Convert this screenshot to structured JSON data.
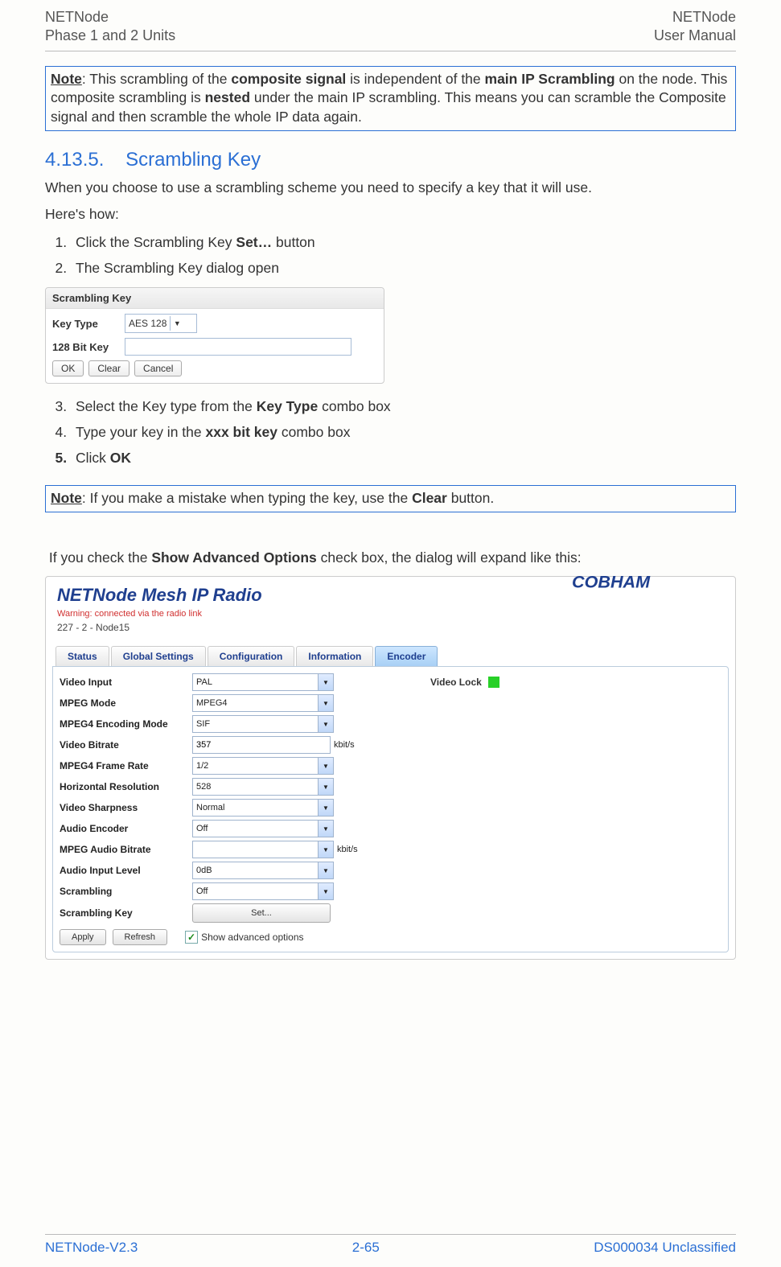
{
  "header": {
    "left_line1": "NETNode",
    "left_line2": "Phase 1 and 2 Units",
    "right_line1": "NETNode",
    "right_line2": "User Manual"
  },
  "note1": {
    "prefix": "Note",
    "text1": ": This scrambling of the ",
    "bold1": "composite signal",
    "text2": " is independent of the ",
    "bold2": "main IP Scrambling",
    "text3": " on the node. This composite scrambling is ",
    "bold3": "nested",
    "text4": " under the main IP scrambling. This means you can scramble the Composite signal and then scramble the whole IP data again."
  },
  "section": {
    "number": "4.13.5.",
    "title": "Scrambling Key"
  },
  "intro1": "When you choose to use a scrambling scheme you need to specify a key that it will use.",
  "intro2": "Here's how:",
  "steps12": {
    "s1_a": "Click the Scrambling Key ",
    "s1_b": "Set…",
    "s1_c": " button",
    "s2": "The Scrambling Key dialog open"
  },
  "sk_dialog": {
    "title": "Scrambling Key",
    "lbl_keytype": "Key Type",
    "val_keytype": "AES 128",
    "lbl_bitkey": "128 Bit Key",
    "btn_ok": "OK",
    "btn_clear": "Clear",
    "btn_cancel": "Cancel"
  },
  "steps345": {
    "s3_a": "Select the Key type from the ",
    "s3_b": "Key Type",
    "s3_c": " combo box",
    "s4_a": "Type your key in the ",
    "s4_b": "xxx bit key",
    "s4_c": " combo box",
    "s5_a": "Click ",
    "s5_b": "OK"
  },
  "note2": {
    "prefix": "Note",
    "t1": ": If you make a mistake when typing the key, use the ",
    "b1": "Clear",
    "t2": " button."
  },
  "advanced_text": {
    "t1": "If you check the ",
    "b1": "Show Advanced Options",
    "t2": " check box, the dialog will expand like this:"
  },
  "encoder": {
    "title": "NETNode Mesh IP Radio",
    "warning": "Warning: connected via the radio link",
    "subtitle": "227 - 2 - Node15",
    "brand": "COBHAM",
    "tabs": [
      "Status",
      "Global Settings",
      "Configuration",
      "Information",
      "Encoder"
    ],
    "active_tab_index": 4,
    "rows": [
      {
        "label": "Video Input",
        "value": "PAL",
        "type": "select"
      },
      {
        "label": "MPEG Mode",
        "value": "MPEG4",
        "type": "select"
      },
      {
        "label": "MPEG4 Encoding Mode",
        "value": "SIF",
        "type": "select"
      },
      {
        "label": "Video Bitrate",
        "value": "357",
        "type": "text",
        "unit": "kbit/s"
      },
      {
        "label": "MPEG4 Frame Rate",
        "value": "1/2",
        "type": "select"
      },
      {
        "label": "Horizontal Resolution",
        "value": "528",
        "type": "select"
      },
      {
        "label": "Video Sharpness",
        "value": "Normal",
        "type": "select"
      },
      {
        "label": "Audio Encoder",
        "value": "Off",
        "type": "select"
      },
      {
        "label": "MPEG Audio Bitrate",
        "value": "",
        "type": "select",
        "unit": "kbit/s"
      },
      {
        "label": "Audio Input Level",
        "value": "0dB",
        "type": "select"
      },
      {
        "label": "Scrambling",
        "value": "Off",
        "type": "select"
      },
      {
        "label": "Scrambling Key",
        "value": "Set...",
        "type": "button"
      }
    ],
    "video_lock_label": "Video Lock",
    "apply": "Apply",
    "refresh": "Refresh",
    "show_advanced": "Show advanced options"
  },
  "footer": {
    "left": "NETNode-V2.3",
    "center": "2-65",
    "right": "DS000034 Unclassified"
  }
}
